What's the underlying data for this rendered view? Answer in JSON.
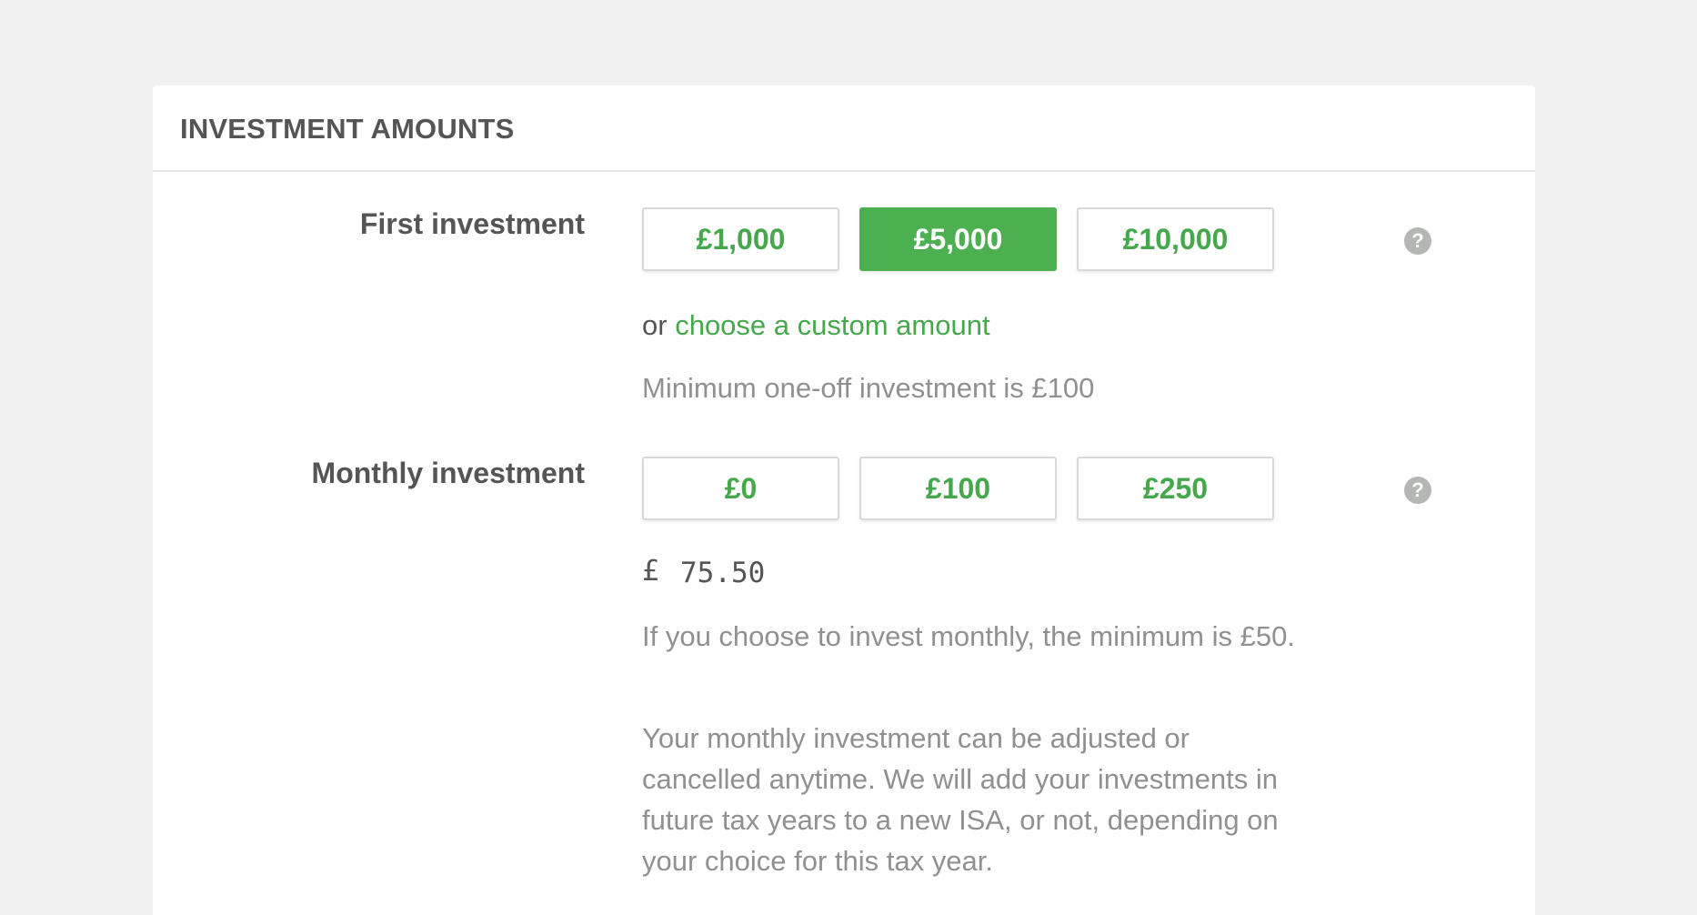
{
  "section": {
    "title": "INVESTMENT AMOUNTS"
  },
  "first_investment": {
    "label": "First investment",
    "options": [
      {
        "label": "£1,000",
        "selected": false
      },
      {
        "label": "£5,000",
        "selected": true
      },
      {
        "label": "£10,000",
        "selected": false
      }
    ],
    "or_text": "or",
    "custom_link": "choose a custom amount",
    "hint": "Minimum one-off investment is £100",
    "help_icon": "question-icon"
  },
  "monthly_investment": {
    "label": "Monthly investment",
    "options": [
      {
        "label": "£0",
        "selected": false
      },
      {
        "label": "£100",
        "selected": false
      },
      {
        "label": "£250",
        "selected": false
      }
    ],
    "currency_symbol": "£",
    "input_value": "75.50",
    "hint_minimum": "If you choose to invest monthly, the minimum is £50.",
    "hint_adjust": "Your monthly investment can be adjusted or cancelled anytime. We will add your investments in future tax years to a new ISA, or not, depending on your choice for this tax year.",
    "help_icon": "question-icon"
  },
  "colors": {
    "accent": "#4caf50",
    "background": "#f0f1f0",
    "label": "#555555",
    "hint": "#8f918f"
  }
}
